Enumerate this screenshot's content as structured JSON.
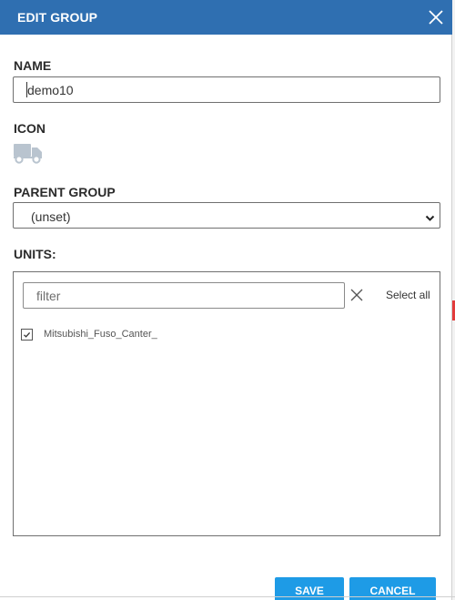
{
  "header": {
    "title": "EDIT GROUP",
    "close_icon": "close-icon"
  },
  "name": {
    "label": "NAME",
    "value": "demo10"
  },
  "icon_section": {
    "label": "ICON",
    "icon": "truck-icon"
  },
  "parent_group": {
    "label": "PARENT GROUP",
    "selected": "(unset)"
  },
  "units": {
    "label": "UNITS:",
    "filter_placeholder": "filter",
    "select_all_label": "Select all",
    "items": [
      {
        "label": "Mitsubishi_Fuso_Canter_",
        "checked": true
      }
    ]
  },
  "actions": {
    "save_label": "SAVE",
    "cancel_label": "CANCEL"
  },
  "colors": {
    "header": "#2f6fb1",
    "button": "#1e9be6",
    "icon": "#b9c4cf"
  }
}
